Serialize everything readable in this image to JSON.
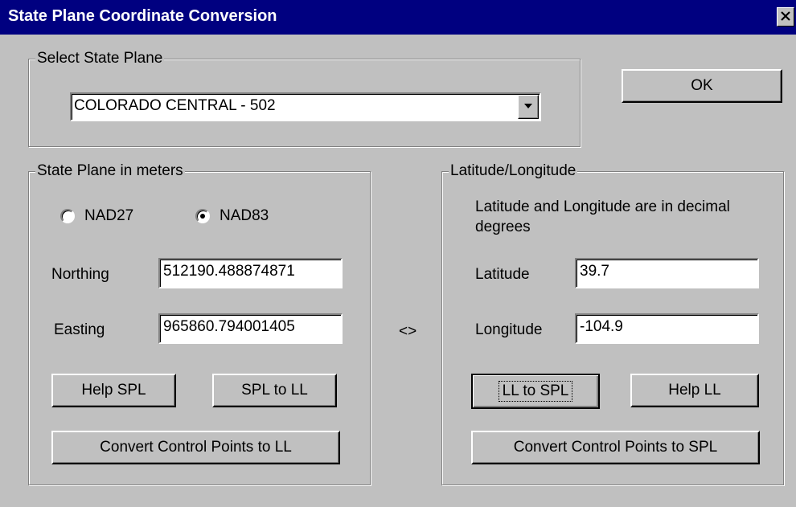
{
  "window": {
    "title": "State Plane Coordinate Conversion",
    "close_glyph": "✕"
  },
  "select_group": {
    "label": "Select State Plane",
    "selected": "COLORADO CENTRAL - 502"
  },
  "ok_label": "OK",
  "spl_group": {
    "label": "State Plane in meters",
    "radio_nad27": "NAD27",
    "radio_nad83": "NAD83",
    "selected_datum": "NAD83",
    "northing_label": "Northing",
    "northing_value": "512190.488874871",
    "easting_label": "Easting",
    "easting_value": "965860.794001405",
    "help_button": "Help SPL",
    "convert_button": "SPL to LL",
    "control_points_button": "Convert Control Points to LL"
  },
  "separator": "<>",
  "ll_group": {
    "label": "Latitude/Longitude",
    "note": "Latitude and Longitude are in decimal degrees",
    "latitude_label": "Latitude",
    "latitude_value": "39.7",
    "longitude_label": "Longitude",
    "longitude_value": "-104.9",
    "convert_button": "LL to SPL",
    "help_button": "Help LL",
    "control_points_button": "Convert Control Points to SPL"
  },
  "icons": {
    "close": "close-icon",
    "dropdown": "chevron-down-icon"
  }
}
